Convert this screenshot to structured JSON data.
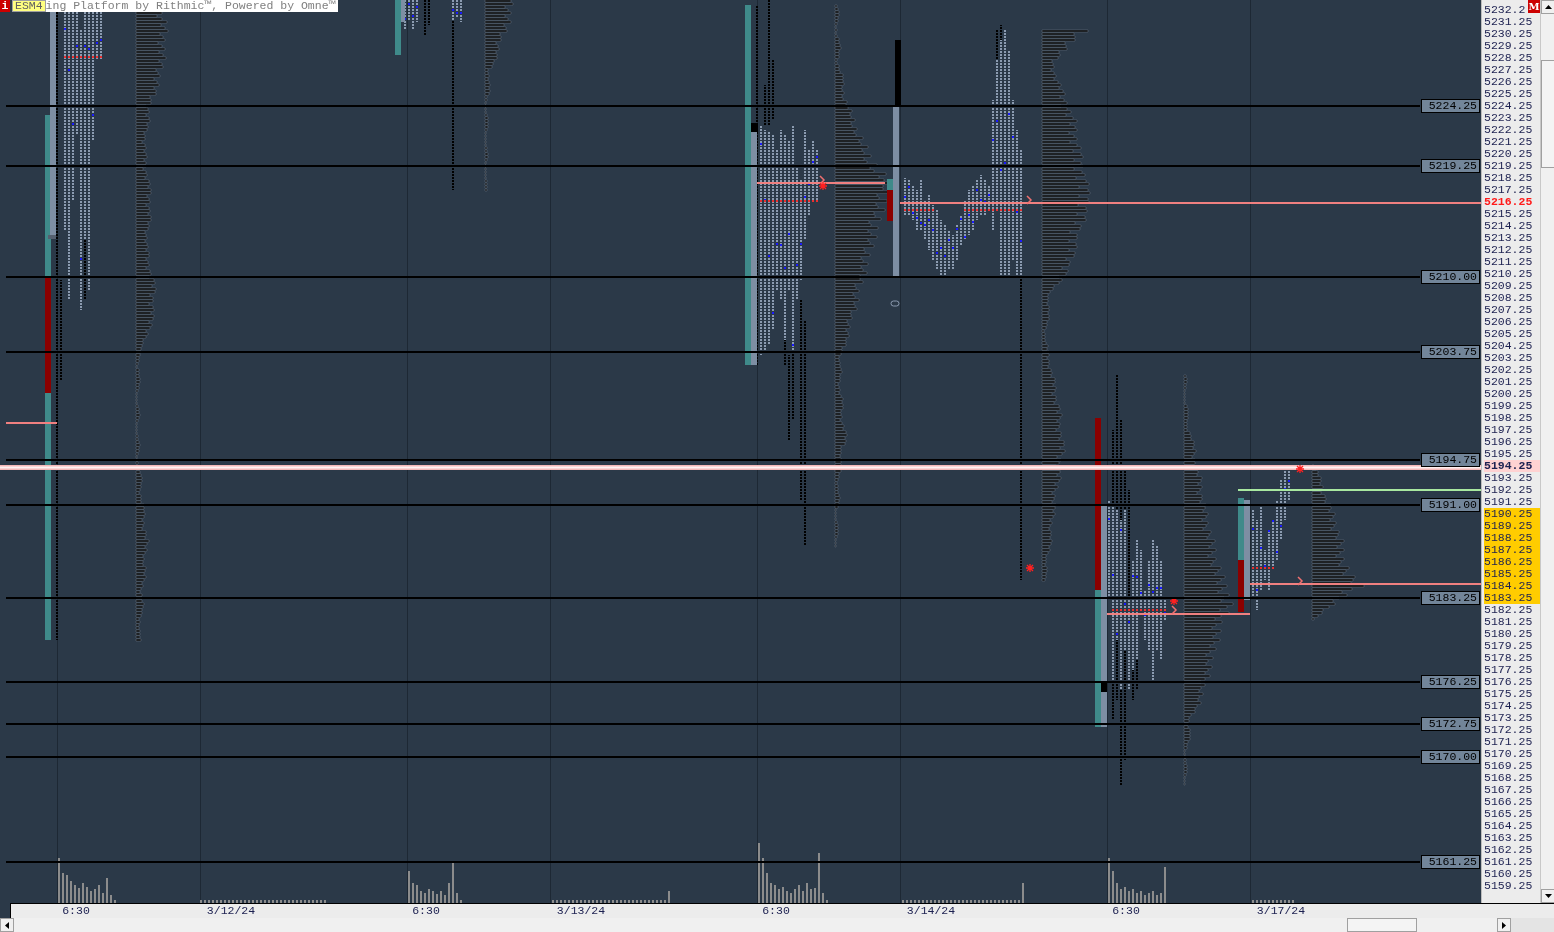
{
  "title_bar": {
    "info_icon": "i",
    "symbol": "ESM4",
    "title": "ing Platform by Rithmic™, Powered by Omne™"
  },
  "levels": [
    {
      "label": "5224.25"
    },
    {
      "label": "5219.25"
    },
    {
      "label": "5210.00"
    },
    {
      "label": "5203.75"
    },
    {
      "label": "5194.75"
    },
    {
      "label": "5191.00"
    },
    {
      "label": "5183.25"
    },
    {
      "label": "5176.25"
    },
    {
      "label": "5172.75"
    },
    {
      "label": "5170.00"
    },
    {
      "label": "5161.25"
    }
  ],
  "price_axis": {
    "badge": "M",
    "labels": [
      {
        "text": "5232.2",
        "kind": "plain"
      },
      {
        "text": "5231.25",
        "kind": "plain"
      },
      {
        "text": "5230.25",
        "kind": "plain"
      },
      {
        "text": "5229.25",
        "kind": "plain"
      },
      {
        "text": "5228.25",
        "kind": "plain"
      },
      {
        "text": "5227.25",
        "kind": "plain"
      },
      {
        "text": "5226.25",
        "kind": "plain"
      },
      {
        "text": "5225.25",
        "kind": "plain"
      },
      {
        "text": "5224.25",
        "kind": "plain"
      },
      {
        "text": "5223.25",
        "kind": "plain"
      },
      {
        "text": "5222.25",
        "kind": "plain"
      },
      {
        "text": "5221.25",
        "kind": "plain"
      },
      {
        "text": "5220.25",
        "kind": "plain"
      },
      {
        "text": "5219.25",
        "kind": "plain"
      },
      {
        "text": "5218.25",
        "kind": "plain"
      },
      {
        "text": "5217.25",
        "kind": "plain"
      },
      {
        "text": "5216.25",
        "kind": "alert"
      },
      {
        "text": "5215.25",
        "kind": "plain"
      },
      {
        "text": "5214.25",
        "kind": "plain"
      },
      {
        "text": "5213.25",
        "kind": "plain"
      },
      {
        "text": "5212.25",
        "kind": "plain"
      },
      {
        "text": "5211.25",
        "kind": "plain"
      },
      {
        "text": "5210.25",
        "kind": "plain"
      },
      {
        "text": "5209.25",
        "kind": "plain"
      },
      {
        "text": "5208.25",
        "kind": "plain"
      },
      {
        "text": "5207.25",
        "kind": "plain"
      },
      {
        "text": "5206.25",
        "kind": "plain"
      },
      {
        "text": "5205.25",
        "kind": "plain"
      },
      {
        "text": "5204.25",
        "kind": "plain"
      },
      {
        "text": "5203.25",
        "kind": "plain"
      },
      {
        "text": "5202.25",
        "kind": "plain"
      },
      {
        "text": "5201.25",
        "kind": "plain"
      },
      {
        "text": "5200.25",
        "kind": "plain"
      },
      {
        "text": "5199.25",
        "kind": "plain"
      },
      {
        "text": "5198.25",
        "kind": "plain"
      },
      {
        "text": "5197.25",
        "kind": "plain"
      },
      {
        "text": "5196.25",
        "kind": "plain"
      },
      {
        "text": "5195.25",
        "kind": "plain"
      },
      {
        "text": "5194.25",
        "kind": "last"
      },
      {
        "text": "5193.25",
        "kind": "plain"
      },
      {
        "text": "5192.25",
        "kind": "plain"
      },
      {
        "text": "5191.25",
        "kind": "plain"
      },
      {
        "text": "5190.25",
        "kind": "value"
      },
      {
        "text": "5189.25",
        "kind": "value"
      },
      {
        "text": "5188.25",
        "kind": "value"
      },
      {
        "text": "5187.25",
        "kind": "value"
      },
      {
        "text": "5186.25",
        "kind": "value"
      },
      {
        "text": "5185.25",
        "kind": "value"
      },
      {
        "text": "5184.25",
        "kind": "value"
      },
      {
        "text": "5183.25",
        "kind": "value"
      },
      {
        "text": "5182.25",
        "kind": "plain"
      },
      {
        "text": "5181.25",
        "kind": "plain"
      },
      {
        "text": "5180.25",
        "kind": "plain"
      },
      {
        "text": "5179.25",
        "kind": "plain"
      },
      {
        "text": "5178.25",
        "kind": "plain"
      },
      {
        "text": "5177.25",
        "kind": "plain"
      },
      {
        "text": "5176.25",
        "kind": "plain"
      },
      {
        "text": "5175.25",
        "kind": "plain"
      },
      {
        "text": "5174.25",
        "kind": "plain"
      },
      {
        "text": "5173.25",
        "kind": "plain"
      },
      {
        "text": "5172.25",
        "kind": "plain"
      },
      {
        "text": "5171.25",
        "kind": "plain"
      },
      {
        "text": "5170.25",
        "kind": "plain"
      },
      {
        "text": "5169.25",
        "kind": "plain"
      },
      {
        "text": "5168.25",
        "kind": "plain"
      },
      {
        "text": "5167.25",
        "kind": "plain"
      },
      {
        "text": "5166.25",
        "kind": "plain"
      },
      {
        "text": "5165.25",
        "kind": "plain"
      },
      {
        "text": "5164.25",
        "kind": "plain"
      },
      {
        "text": "5163.25",
        "kind": "plain"
      },
      {
        "text": "5162.25",
        "kind": "plain"
      },
      {
        "text": "5161.25",
        "kind": "plain"
      },
      {
        "text": "5160.25",
        "kind": "plain"
      },
      {
        "text": "5159.25",
        "kind": "plain"
      }
    ]
  },
  "time_axis": {
    "labels": [
      "6:30",
      "3/12/24",
      "6:30",
      "3/13/24",
      "6:30",
      "3/14/24",
      "6:30",
      "3/17/24"
    ]
  }
}
